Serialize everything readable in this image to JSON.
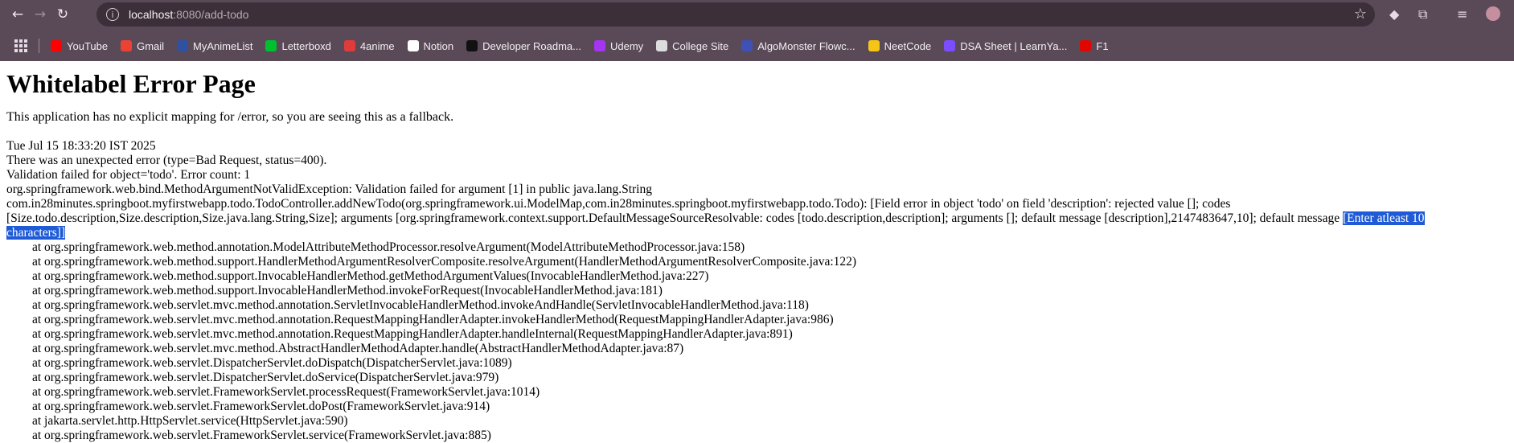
{
  "browser": {
    "url_host": "localhost",
    "url_path": ":8080/add-todo",
    "bookmarks": [
      {
        "label": "YouTube",
        "color": "#ff0000"
      },
      {
        "label": "Gmail",
        "color": "#ea4335"
      },
      {
        "label": "MyAnimeList",
        "color": "#2e51a2"
      },
      {
        "label": "Letterboxd",
        "color": "#00c030"
      },
      {
        "label": "4anime",
        "color": "#e03b3b"
      },
      {
        "label": "Notion",
        "color": "#ffffff"
      },
      {
        "label": "Developer Roadma...",
        "color": "#111111"
      },
      {
        "label": "Udemy",
        "color": "#a435f0"
      },
      {
        "label": "College Site",
        "color": "#dddddd"
      },
      {
        "label": "AlgoMonster Flowc...",
        "color": "#3f51b5"
      },
      {
        "label": "NeetCode",
        "color": "#f5c518"
      },
      {
        "label": "DSA Sheet | LearnYa...",
        "color": "#7c4dff"
      },
      {
        "label": "F1",
        "color": "#e10600"
      }
    ]
  },
  "page": {
    "title": "Whitelabel Error Page",
    "lead": "This application has no explicit mapping for /error, so you are seeing this as a fallback.",
    "timestamp": "Tue Jul 15 18:33:20 IST 2025",
    "error_line": "There was an unexpected error (type=Bad Request, status=400).",
    "validation_line": "Validation failed for object='todo'. Error count: 1",
    "exception_1": "org.springframework.web.bind.MethodArgumentNotValidException: Validation failed for argument [1] in public java.lang.String",
    "exception_2": "com.in28minutes.springboot.myfirstwebapp.todo.TodoController.addNewTodo(org.springframework.ui.ModelMap,com.in28minutes.springboot.myfirstwebapp.todo.Todo): [Field error in object 'todo' on field 'description': rejected value []; codes",
    "exception_3a": "[Size.todo.description,Size.description,Size.java.lang.String,Size]; arguments [org.springframework.context.support.DefaultMessageSourceResolvable: codes [todo.description,description]; arguments []; default message [description],2147483647,10]; default message ",
    "exception_3b": "[Enter atleast 10",
    "exception_4": "characters]]",
    "trace": [
      "at org.springframework.web.method.annotation.ModelAttributeMethodProcessor.resolveArgument(ModelAttributeMethodProcessor.java:158)",
      "at org.springframework.web.method.support.HandlerMethodArgumentResolverComposite.resolveArgument(HandlerMethodArgumentResolverComposite.java:122)",
      "at org.springframework.web.method.support.InvocableHandlerMethod.getMethodArgumentValues(InvocableHandlerMethod.java:227)",
      "at org.springframework.web.method.support.InvocableHandlerMethod.invokeForRequest(InvocableHandlerMethod.java:181)",
      "at org.springframework.web.servlet.mvc.method.annotation.ServletInvocableHandlerMethod.invokeAndHandle(ServletInvocableHandlerMethod.java:118)",
      "at org.springframework.web.servlet.mvc.method.annotation.RequestMappingHandlerAdapter.invokeHandlerMethod(RequestMappingHandlerAdapter.java:986)",
      "at org.springframework.web.servlet.mvc.method.annotation.RequestMappingHandlerAdapter.handleInternal(RequestMappingHandlerAdapter.java:891)",
      "at org.springframework.web.servlet.mvc.method.AbstractHandlerMethodAdapter.handle(AbstractHandlerMethodAdapter.java:87)",
      "at org.springframework.web.servlet.DispatcherServlet.doDispatch(DispatcherServlet.java:1089)",
      "at org.springframework.web.servlet.DispatcherServlet.doService(DispatcherServlet.java:979)",
      "at org.springframework.web.servlet.FrameworkServlet.processRequest(FrameworkServlet.java:1014)",
      "at org.springframework.web.servlet.FrameworkServlet.doPost(FrameworkServlet.java:914)",
      "at jakarta.servlet.http.HttpServlet.service(HttpServlet.java:590)",
      "at org.springframework.web.servlet.FrameworkServlet.service(FrameworkServlet.java:885)"
    ]
  }
}
